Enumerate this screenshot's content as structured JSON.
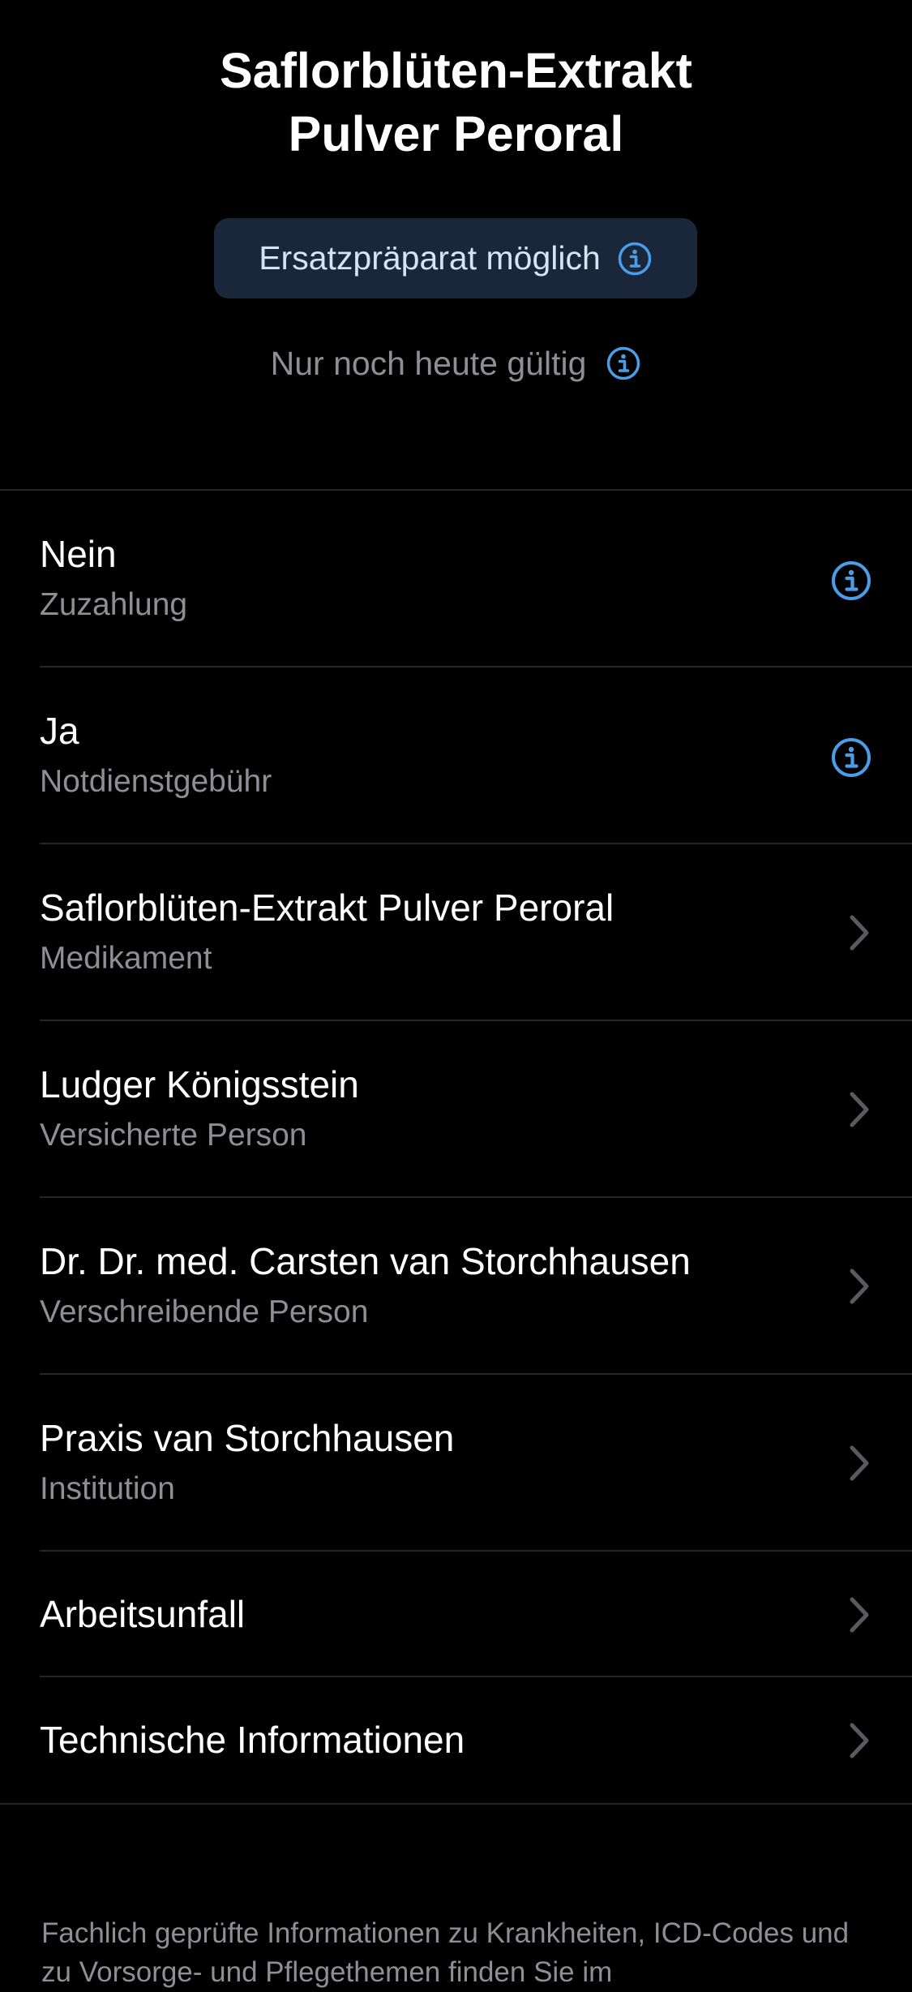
{
  "header": {
    "title_line1": "Saflorblüten-Extrakt",
    "title_line2": "Pulver Peroral",
    "badge_label": "Ersatzpräparat möglich",
    "badge_icon": "info-icon",
    "validity_label": "Nur noch heute gültig",
    "validity_icon": "info-icon"
  },
  "rows": [
    {
      "title": "Nein",
      "subtitle": "Zuzahlung",
      "accessory": "info-icon"
    },
    {
      "title": "Ja",
      "subtitle": "Notdienstgebühr",
      "accessory": "info-icon"
    },
    {
      "title": "Saflorblüten-Extrakt Pulver Peroral",
      "subtitle": "Medikament",
      "accessory": "chevron-right-icon"
    },
    {
      "title": "Ludger Königsstein",
      "subtitle": "Versicherte Person",
      "accessory": "chevron-right-icon"
    },
    {
      "title": "Dr. Dr. med. Carsten van Storchhausen",
      "subtitle": "Verschreibende Person",
      "accessory": "chevron-right-icon"
    },
    {
      "title": "Praxis van Storchhausen",
      "subtitle": "Institution",
      "accessory": "chevron-right-icon"
    },
    {
      "title": "Arbeitsunfall",
      "accessory": "chevron-right-icon"
    },
    {
      "title": "Technische Informationen",
      "accessory": "chevron-right-icon"
    }
  ],
  "footer": {
    "text": "Fachlich geprüfte Informationen zu Krankheiten, ICD-Codes und zu Vorsorge- und Pflegethemen finden Sie im"
  },
  "colors": {
    "background": "#000000",
    "accent": "#4a9ee8",
    "badge_background": "#1a2639",
    "secondary_text": "#8e8e93",
    "separator": "#262628",
    "chevron": "#5a5a5e"
  }
}
